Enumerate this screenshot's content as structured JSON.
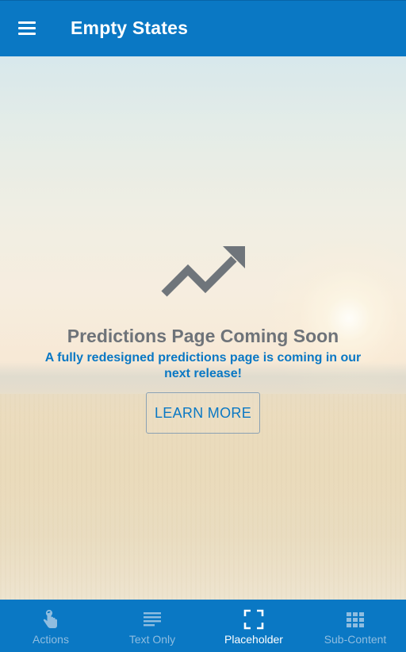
{
  "header": {
    "title": "Empty States",
    "menu_icon": "menu-icon"
  },
  "empty_state": {
    "icon": "trending-up-icon",
    "title": "Predictions Page Coming Soon",
    "subtitle": "A fully redesigned predictions page is coming in our next release!",
    "button_label": "LEARN MORE"
  },
  "bottom_nav": {
    "items": [
      {
        "label": "Actions",
        "icon": "touch-icon",
        "active": false
      },
      {
        "label": "Text Only",
        "icon": "text-lines-icon",
        "active": false
      },
      {
        "label": "Placeholder",
        "icon": "fullscreen-icon",
        "active": true
      },
      {
        "label": "Sub-Content",
        "icon": "grid-icon",
        "active": false
      }
    ]
  },
  "colors": {
    "primary": "#0a78c4",
    "inactive_nav": "#8fbde0",
    "title_gray": "#6e7379"
  }
}
